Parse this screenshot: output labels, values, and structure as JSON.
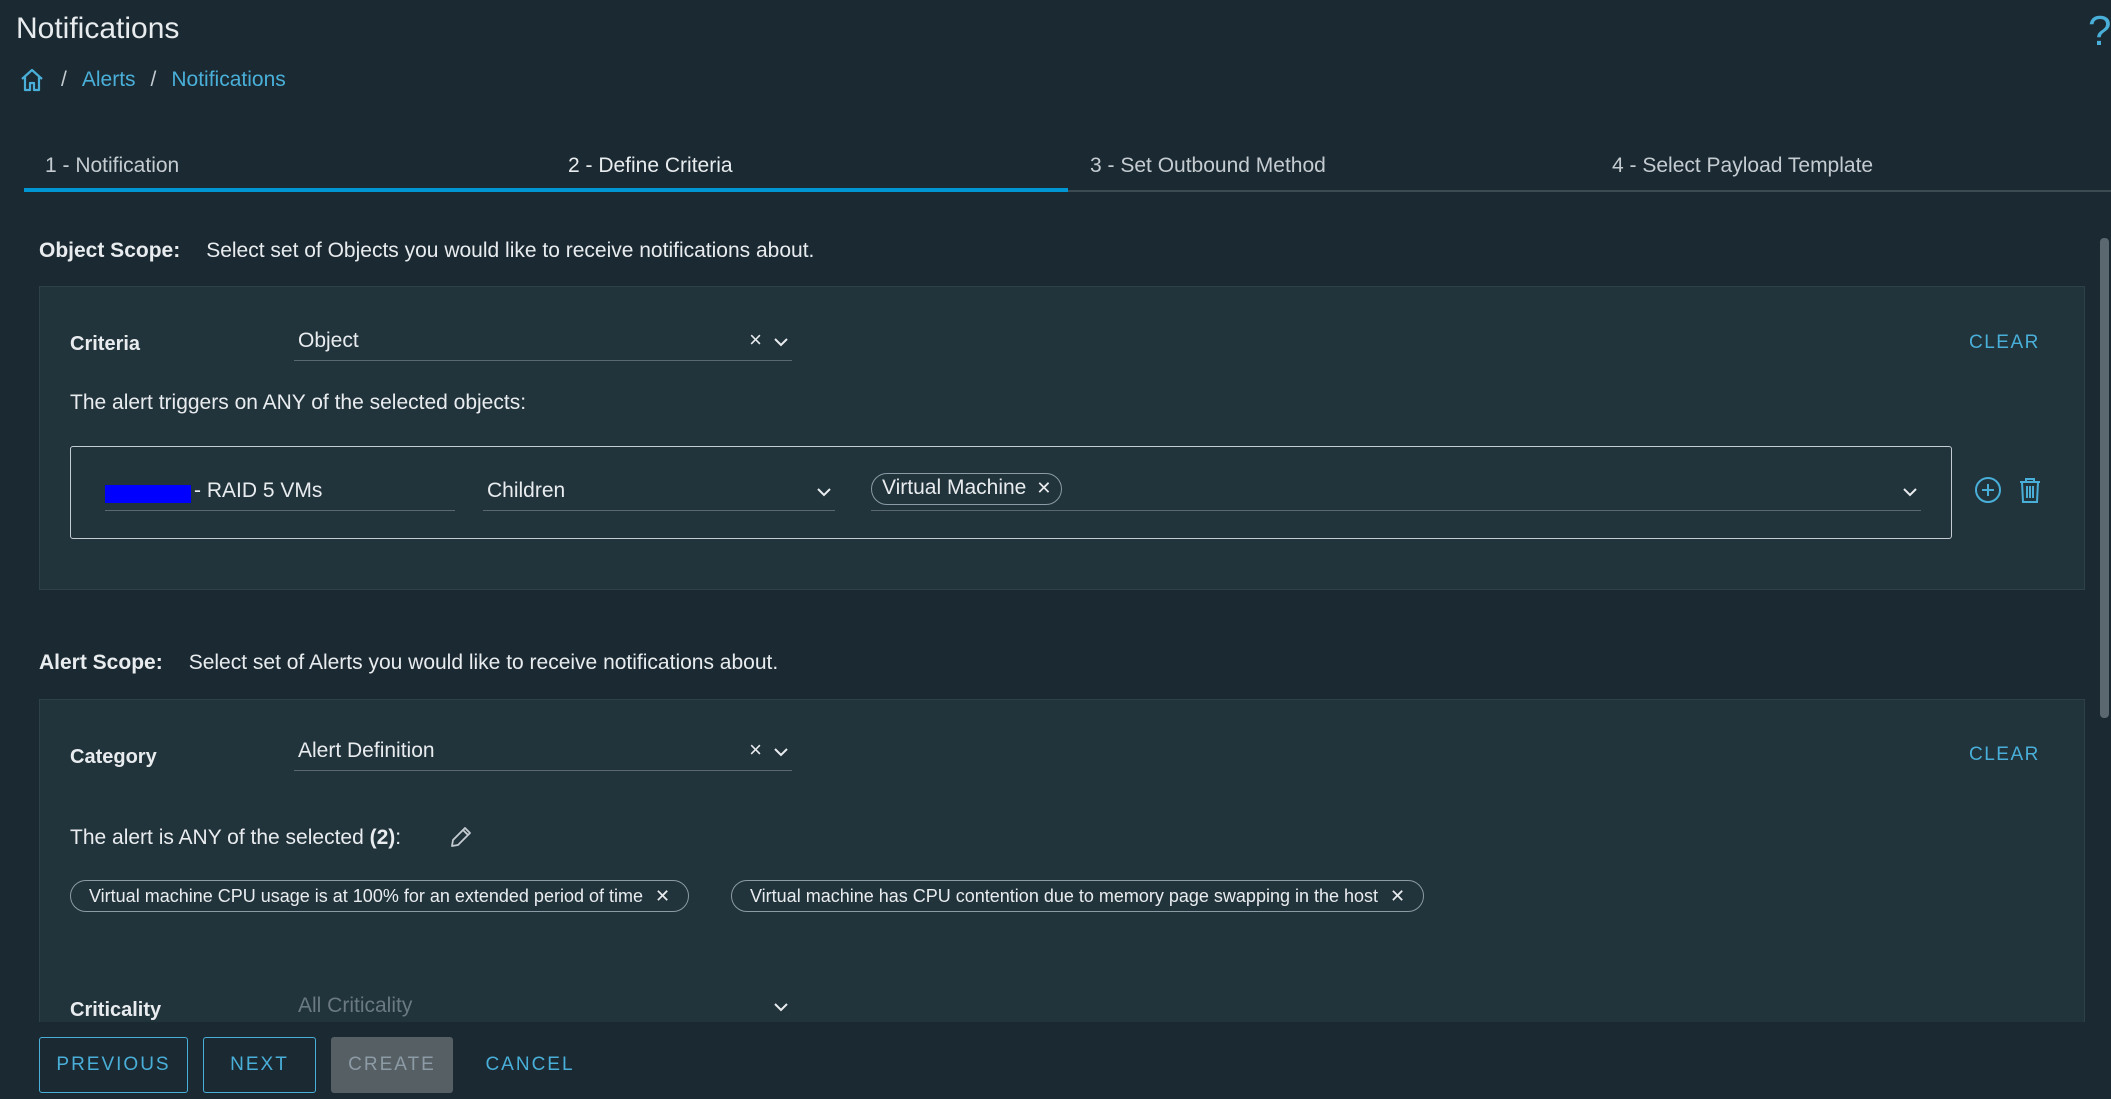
{
  "header": {
    "title": "Notifications",
    "help": "?",
    "breadcrumb": {
      "items": [
        "Alerts",
        "Notifications"
      ],
      "separator": "/"
    }
  },
  "wizard": {
    "steps": [
      "1 - Notification",
      "2 - Define Criteria",
      "3 - Set Outbound Method",
      "4 - Select Payload Template"
    ],
    "active_step": 2
  },
  "object_scope": {
    "label": "Object Scope:",
    "description": "Select set of Objects you would like to receive notifications about.",
    "criteria_label": "Criteria",
    "criteria_value": "Object",
    "clear": "CLEAR",
    "trigger_text": "The alert triggers on ANY of the selected objects:",
    "row": {
      "object_name": "- RAID 5 VMs",
      "relationship": "Children",
      "types": [
        "Virtual Machine"
      ]
    }
  },
  "alert_scope": {
    "label": "Alert Scope:",
    "description": "Select set of Alerts you would like to receive notifications about.",
    "category_label": "Category",
    "category_value": "Alert Definition",
    "clear": "CLEAR",
    "selected_prefix": "The alert is ANY of the selected ",
    "selected_count": "(2)",
    "selected_suffix": ":",
    "alerts": [
      "Virtual machine CPU usage is at 100% for an extended period of time",
      "Virtual machine has CPU contention due to memory page swapping in the host"
    ],
    "criticality_label": "Criticality",
    "criticality_placeholder": "All Criticality"
  },
  "footer": {
    "previous": "PREVIOUS",
    "next": "NEXT",
    "create": "CREATE",
    "cancel": "CANCEL"
  },
  "colors": {
    "background": "#1b2a32",
    "panel": "#21333b",
    "accent": "#49afd9",
    "progress": "#0095d3",
    "redaction": "#0000ff"
  }
}
